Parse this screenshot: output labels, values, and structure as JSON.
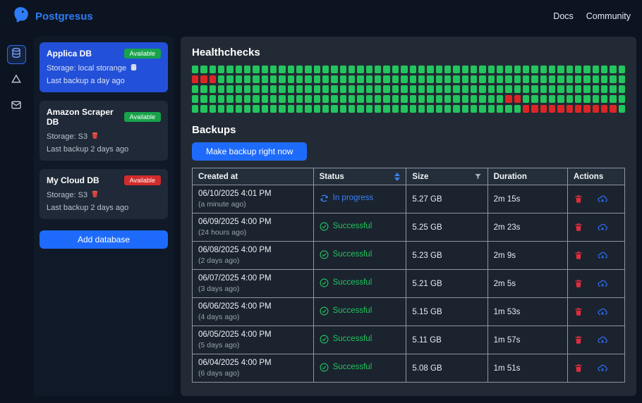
{
  "header": {
    "brand": "Postgresus",
    "links": [
      {
        "label": "Docs"
      },
      {
        "label": "Community"
      }
    ]
  },
  "nav_rail": {
    "items": [
      {
        "name": "databases",
        "selected": true
      },
      {
        "name": "storage",
        "selected": false
      },
      {
        "name": "notifications",
        "selected": false
      }
    ]
  },
  "sidebar": {
    "databases": [
      {
        "name": "Applica DB",
        "badge": "Available",
        "badge_color": "#17a34a",
        "storage": "Storage: local storange",
        "storage_icon": "disk-icon",
        "last_backup": "Last backup a day ago",
        "selected": true
      },
      {
        "name": "Amazon Scraper DB",
        "badge": "Available",
        "badge_color": "#17a34a",
        "storage": "Storage: S3",
        "storage_icon": "s3-bucket-icon",
        "last_backup": "Last backup 2 days ago",
        "selected": false
      },
      {
        "name": "My Cloud DB",
        "badge": "Available",
        "badge_color": "#d32b2b",
        "storage": "Storage: S3",
        "storage_icon": "s3-bucket-icon",
        "last_backup": "Last backup 2 days ago",
        "selected": false
      }
    ],
    "add_button": "Add database"
  },
  "main": {
    "healthchecks_title": "Healthchecks",
    "backups_title": "Backups",
    "make_backup_button": "Make backup right now"
  },
  "healthchecks": {
    "rows": 5,
    "cols": 50,
    "green": "#22c55e",
    "red": "#dc2626",
    "red_cells": [
      [
        1,
        0
      ],
      [
        1,
        1
      ],
      [
        1,
        2
      ],
      [
        3,
        36
      ],
      [
        3,
        37
      ],
      [
        4,
        38
      ],
      [
        4,
        39
      ],
      [
        4,
        40
      ],
      [
        4,
        41
      ],
      [
        4,
        42
      ],
      [
        4,
        43
      ],
      [
        4,
        44
      ],
      [
        4,
        45
      ],
      [
        4,
        46
      ],
      [
        4,
        47
      ],
      [
        4,
        48
      ]
    ]
  },
  "table": {
    "columns": [
      "Created at",
      "Status",
      "Size",
      "Duration",
      "Actions"
    ],
    "rows": [
      {
        "created": "06/10/2025 4:01 PM",
        "ago": "(a minute ago)",
        "status": "In progress",
        "status_type": "progress",
        "size": "5.27 GB",
        "duration": "2m 15s"
      },
      {
        "created": "06/09/2025 4:00 PM",
        "ago": "(24 hours ago)",
        "status": "Successful",
        "status_type": "success",
        "size": "5.25 GB",
        "duration": "2m 23s"
      },
      {
        "created": "06/08/2025 4:00 PM",
        "ago": "(2 days ago)",
        "status": "Successful",
        "status_type": "success",
        "size": "5.23 GB",
        "duration": "2m 9s"
      },
      {
        "created": "06/07/2025 4:00 PM",
        "ago": "(3 days ago)",
        "status": "Successful",
        "status_type": "success",
        "size": "5.21 GB",
        "duration": "2m 5s"
      },
      {
        "created": "06/06/2025 4:00 PM",
        "ago": "(4 days ago)",
        "status": "Successful",
        "status_type": "success",
        "size": "5.15 GB",
        "duration": "1m 53s"
      },
      {
        "created": "06/05/2025 4:00 PM",
        "ago": "(5 days ago)",
        "status": "Successful",
        "status_type": "success",
        "size": "5.11 GB",
        "duration": "1m 57s"
      },
      {
        "created": "06/04/2025 4:00 PM",
        "ago": "(6 days ago)",
        "status": "Successful",
        "status_type": "success",
        "size": "5.08 GB",
        "duration": "1m 51s"
      }
    ]
  },
  "colors": {
    "accent_blue": "#1e6bfb",
    "brand_blue": "#2e7cf6",
    "status_progress": "#3b82f6",
    "status_success": "#22c55e",
    "danger_red": "#e02d3c",
    "badge_green": "#17a34a",
    "badge_red": "#d32b2b"
  }
}
